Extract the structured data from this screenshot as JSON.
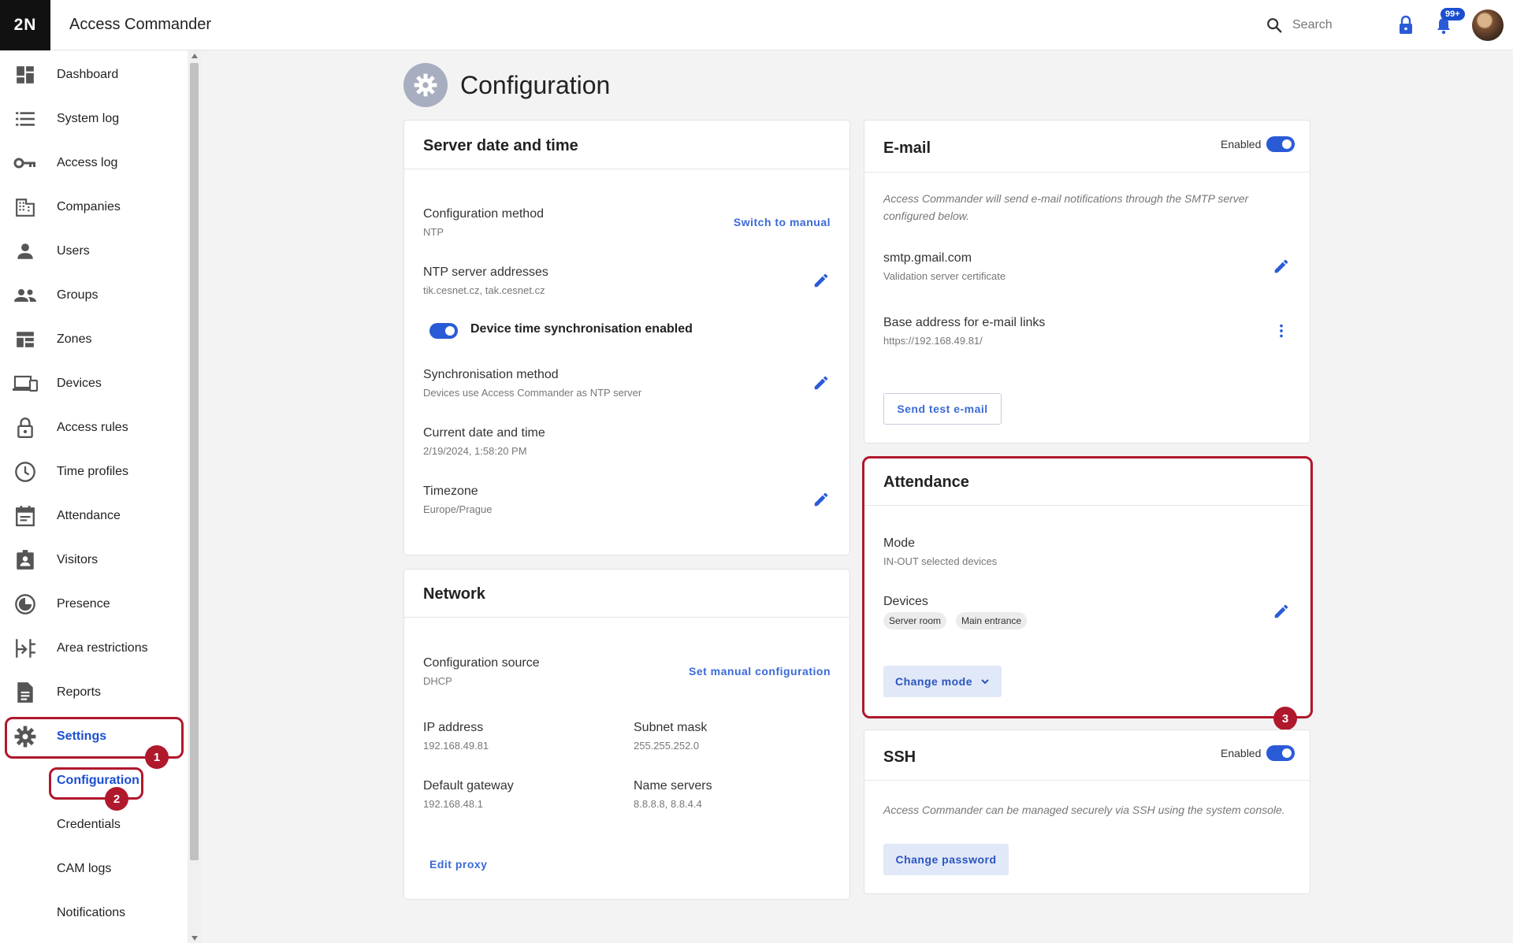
{
  "topbar": {
    "logo": "2N",
    "title": "Access Commander",
    "search_placeholder": "Search",
    "notifications_badge": "99+"
  },
  "sidebar": {
    "items": [
      {
        "label": "Dashboard",
        "icon": "dashboard-icon"
      },
      {
        "label": "System log",
        "icon": "list-icon"
      },
      {
        "label": "Access log",
        "icon": "key-icon"
      },
      {
        "label": "Companies",
        "icon": "building-icon"
      },
      {
        "label": "Users",
        "icon": "user-icon"
      },
      {
        "label": "Groups",
        "icon": "group-icon"
      },
      {
        "label": "Zones",
        "icon": "zones-icon"
      },
      {
        "label": "Devices",
        "icon": "devices-icon"
      },
      {
        "label": "Access rules",
        "icon": "padlock-icon"
      },
      {
        "label": "Time profiles",
        "icon": "clock-icon"
      },
      {
        "label": "Attendance",
        "icon": "calendar-icon"
      },
      {
        "label": "Visitors",
        "icon": "badge-icon"
      },
      {
        "label": "Presence",
        "icon": "presence-icon"
      },
      {
        "label": "Area restrictions",
        "icon": "area-icon"
      },
      {
        "label": "Reports",
        "icon": "report-icon"
      },
      {
        "label": "Settings",
        "icon": "gear-icon"
      }
    ],
    "sub_items": [
      "Configuration",
      "Credentials",
      "CAM logs",
      "Notifications"
    ],
    "markers": [
      "1",
      "2",
      "3"
    ]
  },
  "page": {
    "title": "Configuration"
  },
  "server_time": {
    "title": "Server date and time",
    "config_method_label": "Configuration method",
    "config_method_value": "NTP",
    "switch_link": "Switch to manual",
    "ntp_label": "NTP server addresses",
    "ntp_value": "tik.cesnet.cz, tak.cesnet.cz",
    "sync_toggle_label": "Device time synchronisation enabled",
    "sync_method_label": "Synchronisation method",
    "sync_method_value": "Devices use Access Commander as NTP server",
    "current_label": "Current date and time",
    "current_value": "2/19/2024, 1:58:20 PM",
    "timezone_label": "Timezone",
    "timezone_value": "Europe/Prague"
  },
  "network": {
    "title": "Network",
    "source_label": "Configuration source",
    "source_value": "DHCP",
    "manual_link": "Set manual configuration",
    "ip_label": "IP address",
    "ip_value": "192.168.49.81",
    "mask_label": "Subnet mask",
    "mask_value": "255.255.252.0",
    "gateway_label": "Default gateway",
    "gateway_value": "192.168.48.1",
    "ns_label": "Name servers",
    "ns_value": "8.8.8.8, 8.8.4.4",
    "proxy_link": "Edit proxy"
  },
  "email": {
    "title": "E-mail",
    "enabled_label": "Enabled",
    "note": "Access Commander will send e-mail notifications through the SMTP server configured below.",
    "smtp_label": "smtp.gmail.com",
    "smtp_value": "Validation server certificate",
    "base_label": "Base address for e-mail links",
    "base_value": "https://192.168.49.81/",
    "test_button": "Send test e-mail"
  },
  "attendance": {
    "title": "Attendance",
    "mode_label": "Mode",
    "mode_value": "IN-OUT selected devices",
    "devices_label": "Devices",
    "devices": [
      "Server room",
      "Main entrance"
    ],
    "change_button": "Change mode"
  },
  "ssh": {
    "title": "SSH",
    "enabled_label": "Enabled",
    "note": "Access Commander can be managed securely via SSH using the system console.",
    "password_button": "Change password"
  },
  "colors": {
    "accent": "#1a4fd0",
    "highlight": "#b0182c"
  }
}
